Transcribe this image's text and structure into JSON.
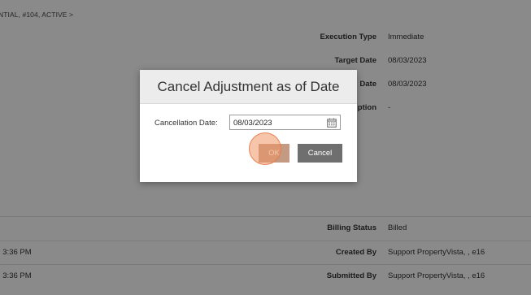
{
  "breadcrumb": "NTIAL, #104, ACTIVE >",
  "fields": [
    {
      "label": "Execution Type",
      "value": "Immediate"
    },
    {
      "label": "Target Date",
      "value": "08/03/2023"
    },
    {
      "label": "Date",
      "value": "08/03/2023"
    },
    {
      "label": "ption",
      "value": "-"
    }
  ],
  "lower_fields": [
    {
      "label": "Billing Status",
      "value": "Billed",
      "left": ""
    },
    {
      "label": "Created By",
      "value": "Support PropertyVista, , e16",
      "left": ", 3:36 PM"
    },
    {
      "label": "Submitted By",
      "value": "Support PropertyVista, , e16",
      "left": ", 3:36 PM"
    }
  ],
  "dialog": {
    "title": "Cancel Adjustment as of Date",
    "field_label": "Cancellation Date:",
    "date_value": "08/03/2023",
    "ok_label": "OK",
    "cancel_label": "Cancel"
  }
}
